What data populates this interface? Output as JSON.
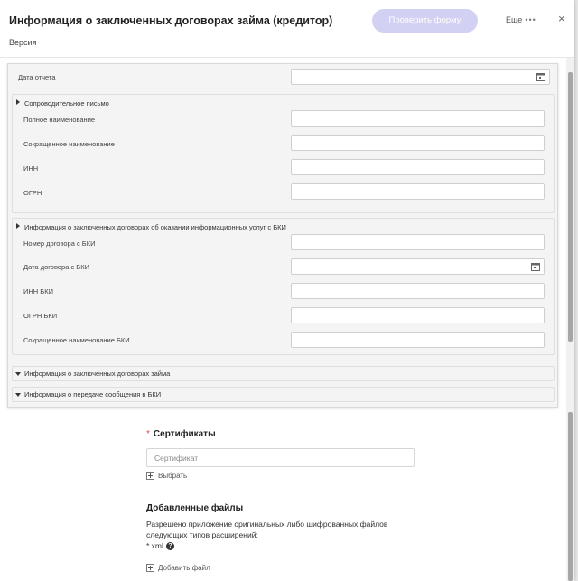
{
  "header": {
    "title": "Информация о заключенных договорах займа (кредитор)",
    "version_label": "Версия",
    "check_button": "Проверить форму",
    "more_label": "Еще",
    "more_dots": "•••",
    "close_symbol": "×"
  },
  "form": {
    "report_date_label": "Дата отчета",
    "cover_letter": {
      "title": "Сопроводительное письмо",
      "full_name_label": "Полное наименование",
      "short_name_label": "Сокращенное наименование",
      "inn_label": "ИНН",
      "ogrn_label": "ОГРН"
    },
    "bki_section": {
      "title": "Информация о заключенных договорах об оказании информационных услуг с БКИ",
      "contract_number_label": "Номер договора с БКИ",
      "contract_date_label": "Дата договора с БКИ",
      "bki_inn_label": "ИНН БКИ",
      "bki_ogrn_label": "ОГРН БКИ",
      "bki_short_name_label": "Сокращенное наименование БКИ"
    },
    "loan_contracts_section": {
      "title": "Информация о заключенных договорах займа"
    },
    "bki_transfer_section": {
      "title": "Информация о передаче сообщения в БКИ"
    }
  },
  "certificates": {
    "required_mark": "*",
    "title": "Сертификаты",
    "placeholder": "Сертификат",
    "select_label": "Выбрать"
  },
  "files": {
    "title": "Добавленные файлы",
    "description": "Разрешено приложение оригинальных либо шифрованных файлов следующих типов расширений:",
    "extension": "*.xml",
    "help_symbol": "?",
    "add_label": "Добавить файл"
  },
  "colors": {
    "accent_button": "#d2d0f3",
    "required": "#e04848"
  }
}
